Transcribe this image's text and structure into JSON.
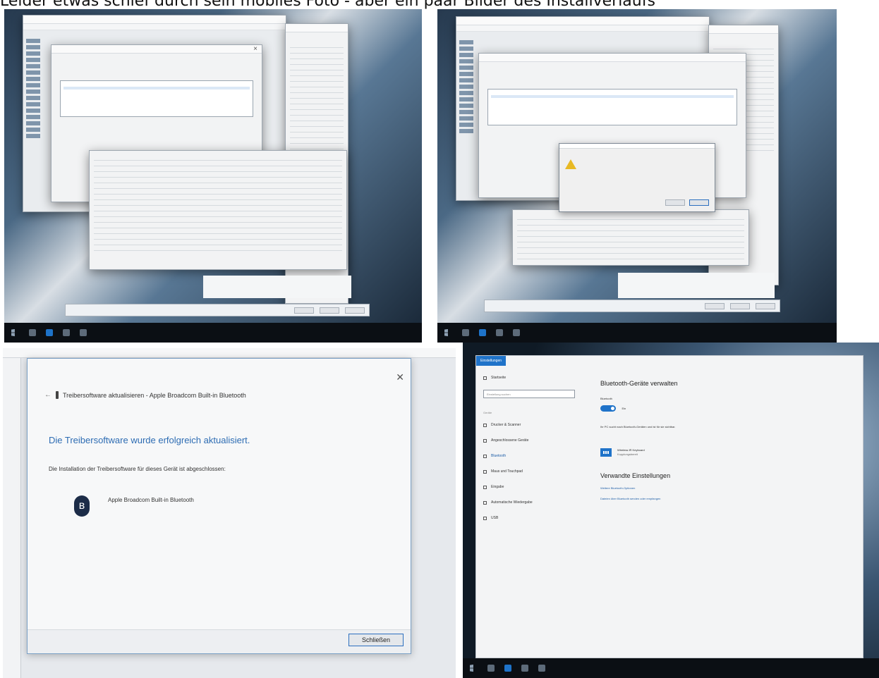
{
  "caption": "Leider etwas schief durch sein mobiles Foto - aber ein paar Bilder des Installverlaufs",
  "panel3": {
    "dialog_title": "Treibersoftware aktualisieren - Apple Broadcom Built-in Bluetooth",
    "success_message": "Die Treibersoftware wurde erfolgreich aktualisiert.",
    "completion_text": "Die Installation der Treibersoftware für dieses Gerät ist abgeschlossen:",
    "device_name": "Apple Broadcom Built-in Bluetooth",
    "close_button": "Schließen",
    "close_icon": "close-icon",
    "device_icon": "bluetooth-icon"
  },
  "panel4": {
    "window_tab": "Einstellungen",
    "nav_home": "Startseite",
    "search_placeholder": "Einstellung suchen",
    "nav_section": "Geräte",
    "nav_items": [
      "Drucker & Scanner",
      "Angeschlossene Geräte",
      "Bluetooth",
      "Maus und Touchpad",
      "Eingabe",
      "Automatische Wiedergabe",
      "USB"
    ],
    "heading": "Bluetooth-Geräte verwalten",
    "toggle_label": "Bluetooth",
    "toggle_state": "Ein",
    "info_text": "Ihr PC sucht nach Bluetooth-Geräten und ist für sie sichtbar.",
    "device_name": "Wireless IR Keyboard",
    "device_status": "Kopplungsbereit",
    "related_heading": "Verwandte Einstellungen",
    "link_more_options": "Weitere Bluetooth-Optionen",
    "link_send_receive": "Dateien über Bluetooth senden oder empfangen"
  }
}
